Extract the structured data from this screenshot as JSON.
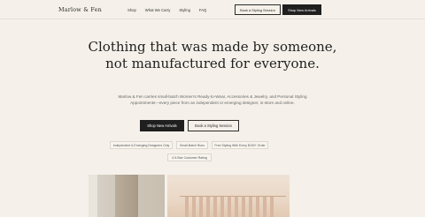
{
  "header": {
    "logo": "Marlow & Fen",
    "nav": [
      {
        "label": "Shop"
      },
      {
        "label": "What We Carry"
      },
      {
        "label": "Styling"
      },
      {
        "label": "FAQ"
      }
    ],
    "book_label": "Book a Styling Session",
    "shop_label": "Shop New Arrivals"
  },
  "hero": {
    "headline": "Clothing that was made by someone, not manufactured for everyone.",
    "description": "Marlow & Fen carries small-batch Women's Ready-to-Wear, Accessories & Jewelry, and Personal Styling Appointments—every piece from an independent or emerging designer, in-store and online.",
    "primary_cta": "Shop New Arrivals",
    "secondary_cta": "Book a Styling Session",
    "badges": [
      "Independent & Emerging Designers Only",
      "Small-Batch Runs",
      "Free Styling With Every $150+ Order",
      "4.9-Star Customer Rating"
    ]
  },
  "images": {
    "left": "storefront-interior-photo",
    "right": "clothing-rack-photo"
  }
}
